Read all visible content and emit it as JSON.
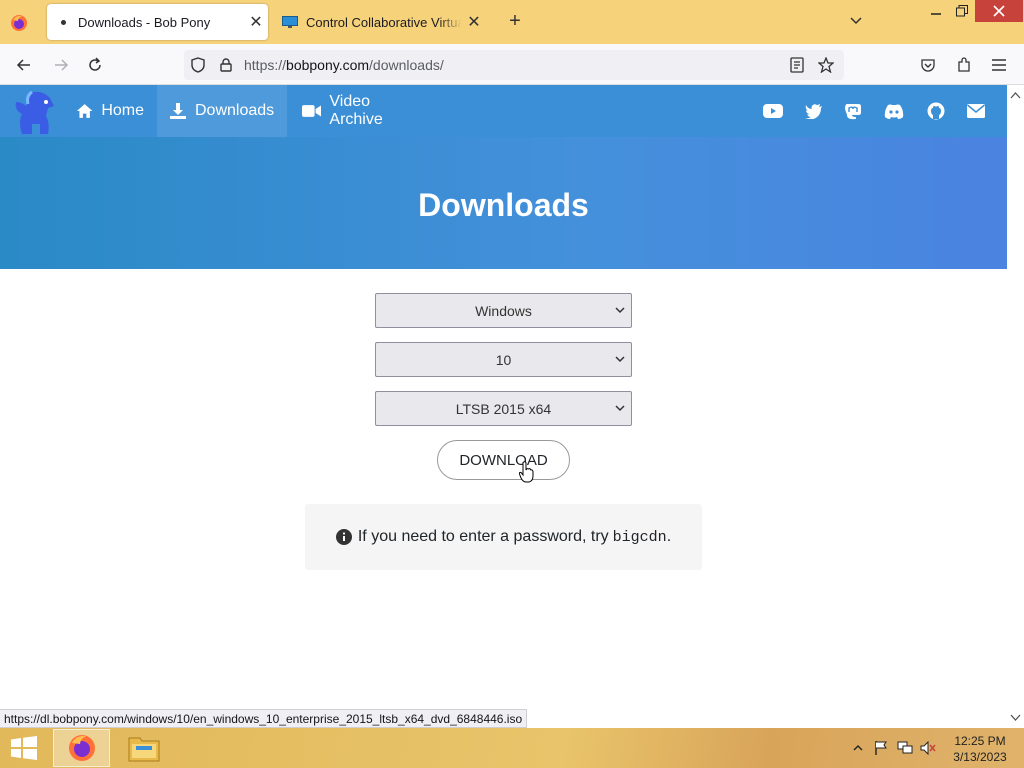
{
  "browser": {
    "tabs": [
      {
        "title": "Downloads - Bob Pony",
        "active": true
      },
      {
        "title": "Control Collaborative Virtual Machine",
        "active": false
      }
    ],
    "url": {
      "scheme": "https://",
      "host": "bobpony.com",
      "path": "/downloads/"
    },
    "status_url": "https://dl.bobpony.com/windows/10/en_windows_10_enterprise_2015_ltsb_x64_dvd_6848446.iso"
  },
  "site": {
    "nav": [
      {
        "label": "Home",
        "icon": "home-icon"
      },
      {
        "label": "Downloads",
        "icon": "download-icon",
        "active": true
      },
      {
        "label": "Video Archive",
        "icon": "video-camera-icon"
      }
    ],
    "social_icons": [
      "youtube-icon",
      "twitter-icon",
      "mastodon-icon",
      "discord-icon",
      "github-icon",
      "mail-icon"
    ],
    "hero_title": "Downloads"
  },
  "form": {
    "os_value": "Windows",
    "version_value": "10",
    "edition_value": "LTSB 2015 x64",
    "download_label": "DOWNLOAD"
  },
  "info": {
    "text": "If you need to enter a password, try",
    "password": "bigcdn",
    "suffix": "."
  },
  "taskbar": {
    "time": "12:25 PM",
    "date": "3/13/2023"
  },
  "colors": {
    "titlebar": "#f6d37a",
    "site_nav": "#3a8fd6",
    "hero_start": "#2a8ac6",
    "hero_end": "#4a83e0",
    "close_button": "#c8423c"
  }
}
